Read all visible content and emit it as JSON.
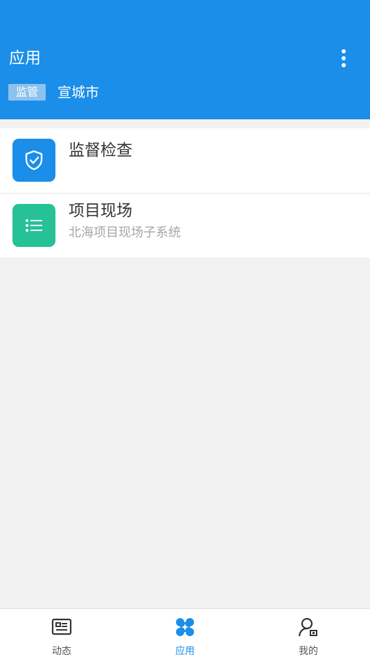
{
  "header": {
    "title": "应用",
    "menu_icon": "more-vertical-icon",
    "tag": "监管",
    "city": "宣城市",
    "bg_color": "#1a8ee8"
  },
  "apps": [
    {
      "name": "监督检查",
      "subtitle": "",
      "icon": "shield-check-icon",
      "color": "#1a8ee8"
    },
    {
      "name": "项目现场",
      "subtitle": "北海项目现场子系统",
      "icon": "list-icon",
      "color": "#26c196"
    }
  ],
  "tabbar": {
    "items": [
      {
        "label": "动态",
        "icon": "news-icon",
        "active": false
      },
      {
        "label": "应用",
        "icon": "apps-icon",
        "active": true
      },
      {
        "label": "我的",
        "icon": "user-icon",
        "active": false
      }
    ],
    "active_color": "#1a8ee8"
  }
}
